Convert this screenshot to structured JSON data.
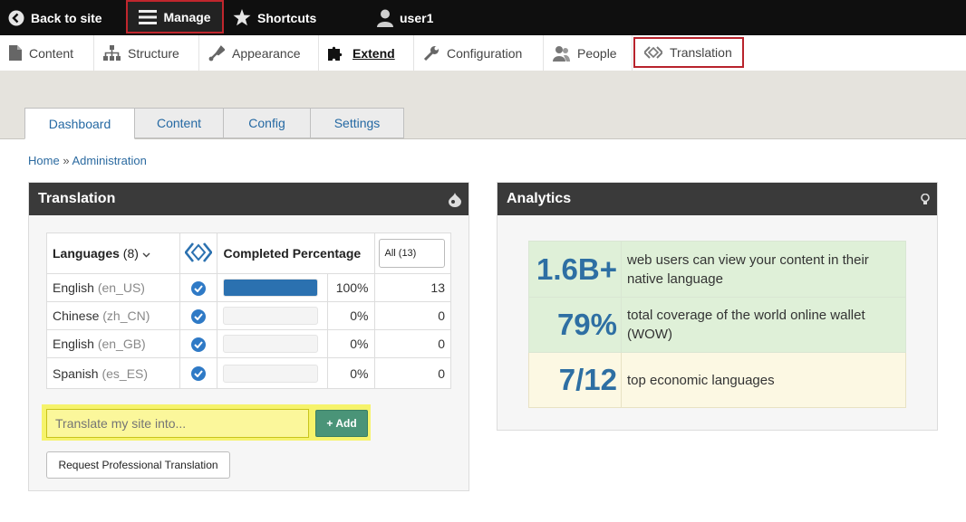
{
  "toolbar": {
    "back": "Back to site",
    "manage": "Manage",
    "shortcuts": "Shortcuts",
    "user": "user1"
  },
  "tray": [
    {
      "label": "Content",
      "icon": "page-icon"
    },
    {
      "label": "Structure",
      "icon": "structure-icon"
    },
    {
      "label": "Appearance",
      "icon": "paintbrush-icon"
    },
    {
      "label": "Extend",
      "icon": "puzzle-icon"
    },
    {
      "label": "Configuration",
      "icon": "wrench-icon"
    },
    {
      "label": "People",
      "icon": "people-icon"
    },
    {
      "label": "Translation",
      "icon": "translation-logo-icon"
    }
  ],
  "tabs": [
    "Dashboard",
    "Content",
    "Config",
    "Settings"
  ],
  "breadcrumb": {
    "home": "Home",
    "sep": "»",
    "admin": "Administration"
  },
  "translation": {
    "title": "Translation",
    "languages_label": "Languages",
    "languages_count": "(8)",
    "completed_label": "Completed Percentage",
    "filter_value": "All (13)",
    "rows": [
      {
        "name": "English",
        "code": "(en_US)",
        "progress": 1.0,
        "pct": "100%",
        "count": "13"
      },
      {
        "name": "Chinese",
        "code": "(zh_CN)",
        "progress": 0.0,
        "pct": "0%",
        "count": "0"
      },
      {
        "name": "English",
        "code": "(en_GB)",
        "progress": 0.0,
        "pct": "0%",
        "count": "0"
      },
      {
        "name": "Spanish",
        "code": "(es_ES)",
        "progress": 0.0,
        "pct": "0%",
        "count": "0"
      }
    ],
    "input_placeholder": "Translate my site into...",
    "add_label": "Add",
    "request_label": "Request Professional Translation"
  },
  "analytics": {
    "title": "Analytics",
    "rows": [
      {
        "big": "1.6B+",
        "text": "web users can view your content in their native language"
      },
      {
        "big": "79%",
        "text": "total coverage of the world online wallet (WOW)"
      },
      {
        "big": "7/12",
        "text": "top economic languages"
      }
    ]
  }
}
